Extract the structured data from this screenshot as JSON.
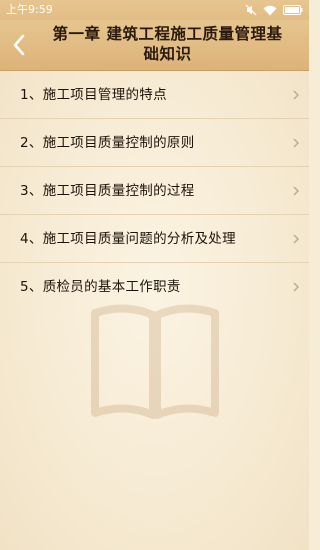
{
  "status_bar": {
    "time": "上午9:59",
    "icons": [
      "mute-icon",
      "wifi-icon",
      "battery-icon"
    ]
  },
  "header": {
    "back_icon": "chevron-left-icon",
    "title": "第一章 建筑工程施工质量管理基础知识"
  },
  "list": {
    "items": [
      {
        "label": "1、施工项目管理的特点"
      },
      {
        "label": "2、施工项目质量控制的原则"
      },
      {
        "label": "3、施工项目质量控制的过程"
      },
      {
        "label": "4、施工项目质量问题的分析及处理"
      },
      {
        "label": "5、质检员的基本工作职责"
      }
    ],
    "chevron_icon": "chevron-right-icon"
  },
  "colors": {
    "header_bg": "#e2bd85",
    "page_bg": "#f7ecd6",
    "text": "#1e130a"
  }
}
